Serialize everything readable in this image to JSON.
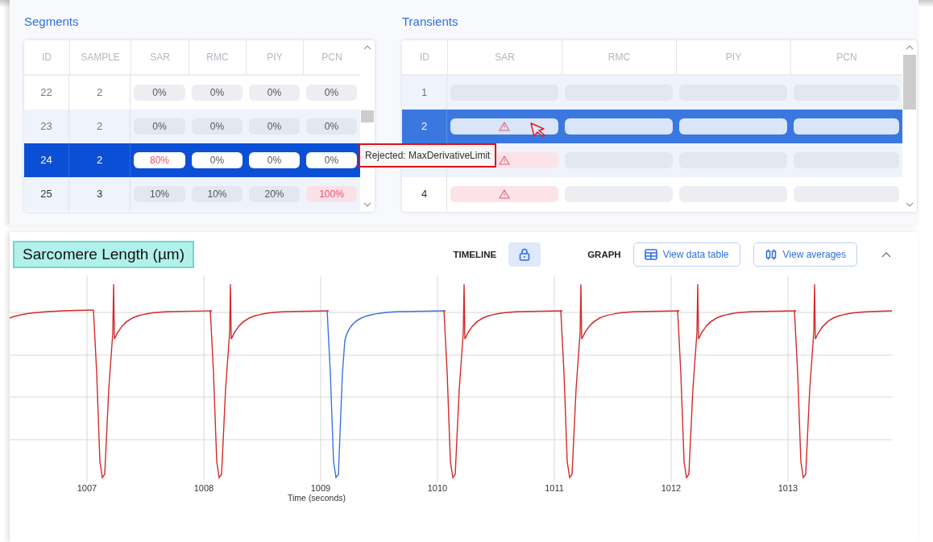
{
  "segments": {
    "title": "Segments",
    "columns": [
      "ID",
      "SAMPLE",
      "SAR",
      "RMC",
      "PIY",
      "PCN"
    ],
    "rows": [
      {
        "selected": false,
        "cells": [
          {
            "kind": "text",
            "text": "22"
          },
          {
            "kind": "text",
            "text": "2"
          },
          {
            "kind": "pill",
            "text": "0%",
            "flagged": false
          },
          {
            "kind": "pill",
            "text": "0%",
            "flagged": false
          },
          {
            "kind": "pill",
            "text": "0%",
            "flagged": false
          },
          {
            "kind": "pill",
            "text": "0%",
            "flagged": false
          }
        ]
      },
      {
        "selected": false,
        "cells": [
          {
            "kind": "text",
            "text": "23"
          },
          {
            "kind": "text",
            "text": "2"
          },
          {
            "kind": "pill",
            "text": "0%",
            "flagged": false
          },
          {
            "kind": "pill",
            "text": "0%",
            "flagged": false
          },
          {
            "kind": "pill",
            "text": "0%",
            "flagged": false
          },
          {
            "kind": "pill",
            "text": "0%",
            "flagged": false
          }
        ]
      },
      {
        "selected": true,
        "cells": [
          {
            "kind": "text",
            "text": "24"
          },
          {
            "kind": "text",
            "text": "2"
          },
          {
            "kind": "pill",
            "text": "80%",
            "flagged": true
          },
          {
            "kind": "pill",
            "text": "0%",
            "flagged": false
          },
          {
            "kind": "pill",
            "text": "0%",
            "flagged": false
          },
          {
            "kind": "pill",
            "text": "0%",
            "flagged": false
          }
        ]
      },
      {
        "selected": false,
        "cells": [
          {
            "kind": "text",
            "text": "25"
          },
          {
            "kind": "text",
            "text": "3"
          },
          {
            "kind": "pill",
            "text": "10%",
            "flagged": false
          },
          {
            "kind": "pill",
            "text": "10%",
            "flagged": false
          },
          {
            "kind": "pill",
            "text": "20%",
            "flagged": false
          },
          {
            "kind": "pill",
            "text": "100%",
            "flagged": true
          }
        ]
      }
    ]
  },
  "tooltip": "Rejected: MaxDerivativeLimit",
  "transients": {
    "title": "Transients",
    "columns": [
      "ID",
      "SAR",
      "RMC",
      "PIY",
      "PCN"
    ],
    "rows": [
      {
        "selected": false,
        "cells": [
          {
            "kind": "text",
            "text": "1"
          },
          {
            "kind": "status",
            "warning": false
          },
          {
            "kind": "status",
            "warning": false
          },
          {
            "kind": "status",
            "warning": false
          },
          {
            "kind": "status",
            "warning": false
          }
        ]
      },
      {
        "selected": true,
        "cells": [
          {
            "kind": "text",
            "text": "2"
          },
          {
            "kind": "status",
            "warning": true
          },
          {
            "kind": "status",
            "warning": false
          },
          {
            "kind": "status",
            "warning": false
          },
          {
            "kind": "status",
            "warning": false
          }
        ]
      },
      {
        "selected": false,
        "cells": [
          {
            "kind": "text",
            "text": ""
          },
          {
            "kind": "status",
            "warning": true
          },
          {
            "kind": "status",
            "warning": false
          },
          {
            "kind": "status",
            "warning": false
          },
          {
            "kind": "status",
            "warning": false
          }
        ]
      },
      {
        "selected": false,
        "cells": [
          {
            "kind": "text",
            "text": "4"
          },
          {
            "kind": "status",
            "warning": true
          },
          {
            "kind": "status",
            "warning": false
          },
          {
            "kind": "status",
            "warning": false
          },
          {
            "kind": "status",
            "warning": false
          }
        ]
      }
    ]
  },
  "graph_panel": {
    "title": "Sarcomere Length (µm)",
    "timeline_label": "TIMELINE",
    "graph_label": "GRAPH",
    "buttons": [
      "View data table",
      "View averages"
    ],
    "xticks": [
      "1007",
      "1008",
      "1009",
      "1010",
      "1011",
      "1012",
      "1013"
    ],
    "xlabel": "Time (seconds)",
    "beats": [
      {
        "selected": false
      },
      {
        "selected": false
      },
      {
        "selected": true
      },
      {
        "selected": false
      },
      {
        "selected": false
      },
      {
        "selected": false
      },
      {
        "selected": false
      }
    ]
  }
}
